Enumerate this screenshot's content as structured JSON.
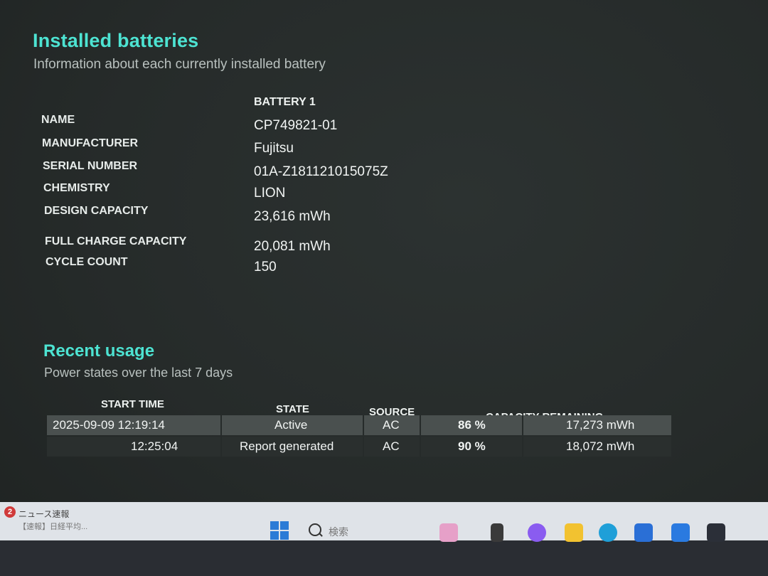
{
  "installed": {
    "title": "Installed batteries",
    "subtitle": "Information about each currently installed battery",
    "battery_header": "BATTERY 1",
    "rows": [
      {
        "label": "NAME",
        "value": "CP749821-01"
      },
      {
        "label": "MANUFACTURER",
        "value": "Fujitsu"
      },
      {
        "label": "SERIAL NUMBER",
        "value": "01A-Z181121015075Z"
      },
      {
        "label": "CHEMISTRY",
        "value": "LION"
      },
      {
        "label": "DESIGN CAPACITY",
        "value": "23,616 mWh"
      },
      {
        "label": "FULL CHARGE CAPACITY",
        "value": "20,081 mWh"
      },
      {
        "label": "CYCLE COUNT",
        "value": "150"
      }
    ]
  },
  "recent": {
    "title": "Recent usage",
    "subtitle": "Power states over the last 7 days",
    "columns": [
      "START TIME",
      "STATE",
      "SOURCE",
      "CAPACITY REMAINING"
    ],
    "rows": [
      {
        "start": "2025-09-09  12:19:14",
        "state": "Active",
        "source": "AC",
        "percent": "86 %",
        "mwh": "17,273 mWh"
      },
      {
        "start": "12:25:04",
        "state": "Report generated",
        "source": "AC",
        "percent": "90 %",
        "mwh": "18,072 mWh"
      }
    ]
  },
  "taskbar": {
    "news_badge": "2",
    "news_title": "ニュース速報",
    "news_line": "【速報】日経平均...",
    "search_placeholder": "検索"
  },
  "colors": {
    "accent": "#4de3d2",
    "background": "#262b2a",
    "row_alt": "#4a504f",
    "taskbar": "#dfe3e8"
  }
}
